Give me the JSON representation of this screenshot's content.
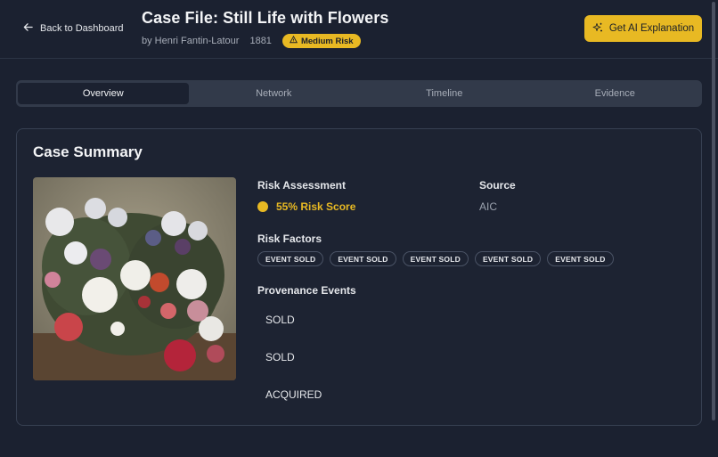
{
  "header": {
    "back_label": "Back to Dashboard",
    "title": "Case File: Still Life with Flowers",
    "artist": "by Henri Fantin-Latour",
    "year": "1881",
    "risk_badge": "Medium Risk",
    "ai_button": "Get AI Explanation"
  },
  "tabs": [
    {
      "label": "Overview",
      "active": true
    },
    {
      "label": "Network",
      "active": false
    },
    {
      "label": "Timeline",
      "active": false
    },
    {
      "label": "Evidence",
      "active": false
    }
  ],
  "summary": {
    "title": "Case Summary",
    "risk_label": "Risk Assessment",
    "risk_score": "55% Risk Score",
    "source_label": "Source",
    "source_value": "AIC",
    "factors_label": "Risk Factors",
    "factors": [
      "EVENT SOLD",
      "EVENT SOLD",
      "EVENT SOLD",
      "EVENT SOLD",
      "EVENT SOLD"
    ],
    "events_label": "Provenance Events",
    "events": [
      "SOLD",
      "SOLD",
      "ACQUIRED"
    ]
  },
  "colors": {
    "accent": "#e8b923",
    "background": "#1b2130",
    "card": "#1d2332"
  }
}
